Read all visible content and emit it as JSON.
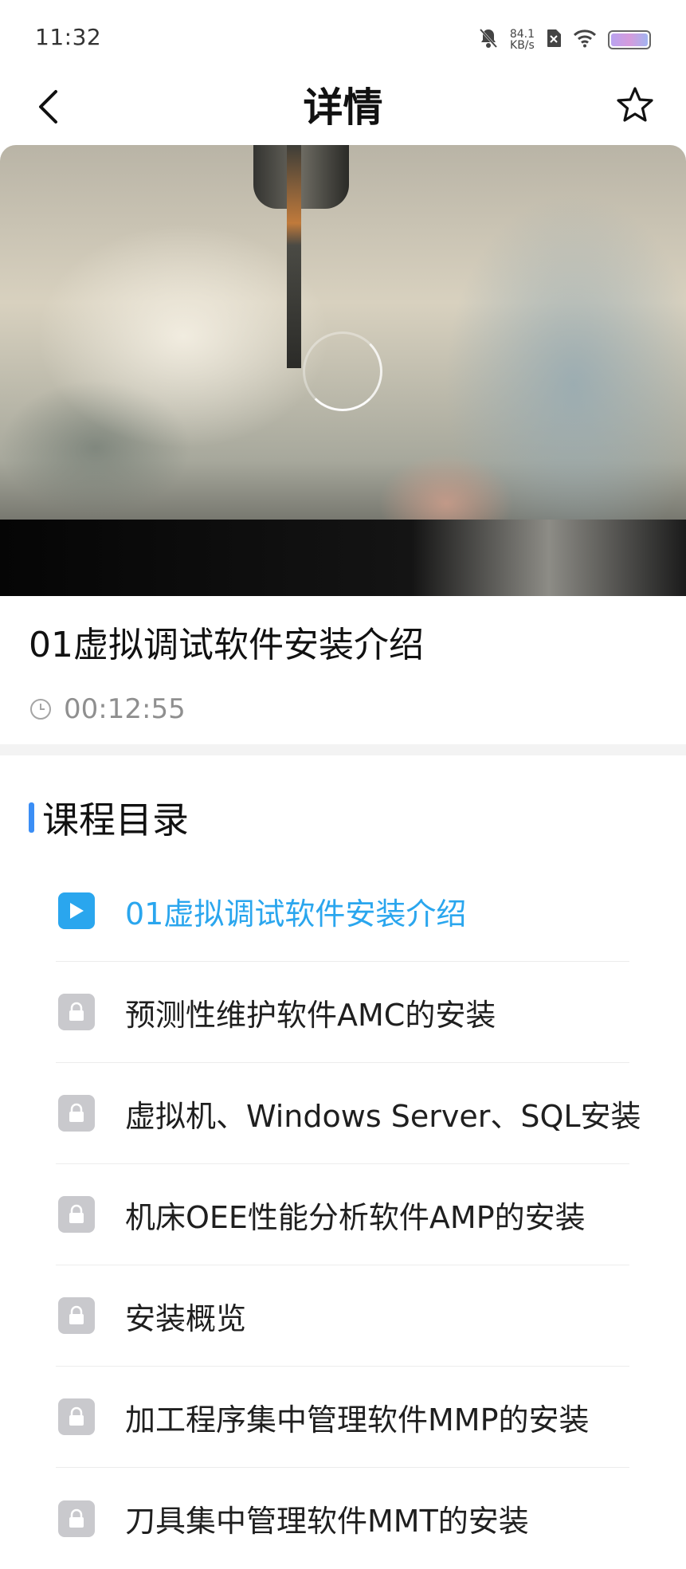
{
  "status_bar": {
    "time": "11:32",
    "net_speed_value": "84.1",
    "net_speed_unit": "KB/s",
    "icons": [
      "mute-icon",
      "sim-off-icon",
      "wifi-icon",
      "battery-icon"
    ]
  },
  "header": {
    "title": "详情",
    "back_icon": "chevron-left-icon",
    "favorite_icon": "star-outline-icon"
  },
  "video": {
    "state": "loading"
  },
  "lesson": {
    "title": "01虚拟调试软件安装介绍",
    "duration": "00:12:55"
  },
  "catalog": {
    "title": "课程目录",
    "accent_color": "#3b8ef5",
    "active_color": "#2aa6ee",
    "items": [
      {
        "label": "01虚拟调试软件安装介绍",
        "status": "playing"
      },
      {
        "label": "预测性维护软件AMC的安装",
        "status": "locked"
      },
      {
        "label": "虚拟机、Windows Server、SQL安装",
        "status": "locked"
      },
      {
        "label": "机床OEE性能分析软件AMP的安装",
        "status": "locked"
      },
      {
        "label": "安装概览",
        "status": "locked"
      },
      {
        "label": "加工程序集中管理软件MMP的安装",
        "status": "locked"
      },
      {
        "label": "刀具集中管理软件MMT的安装",
        "status": "locked"
      }
    ]
  }
}
